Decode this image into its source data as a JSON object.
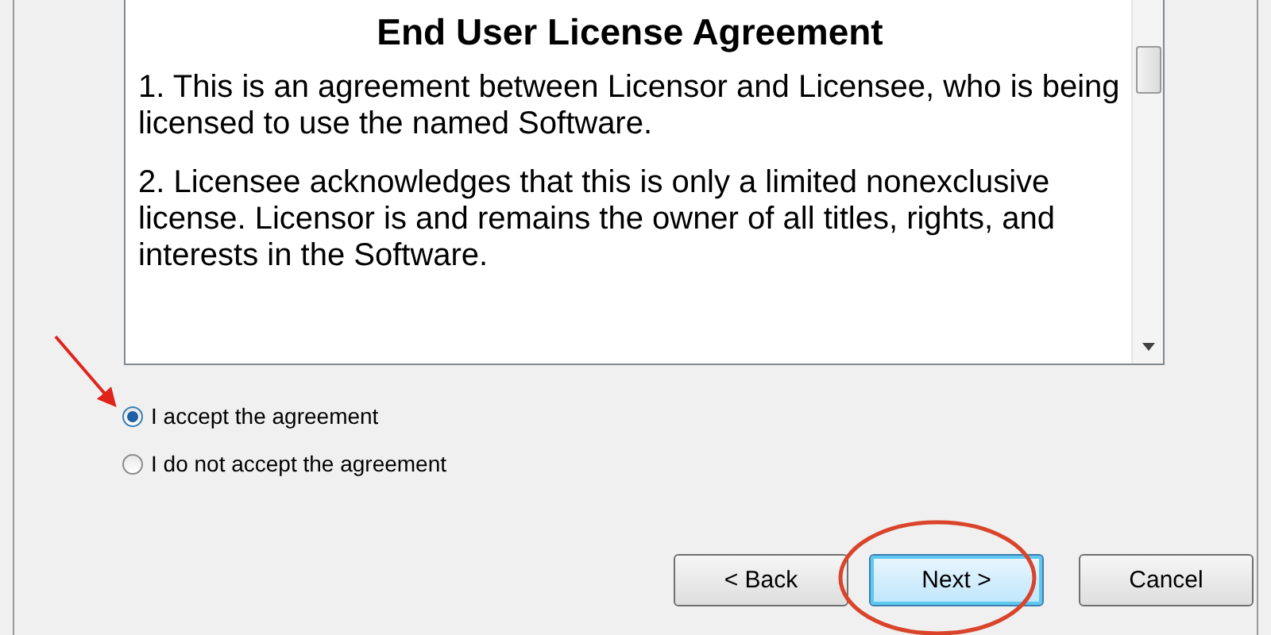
{
  "license": {
    "title": "End User License Agreement",
    "paragraphs": [
      "1. This is an agreement between Licensor and Licensee, who is being licensed to use the named Software.",
      "2. Licensee acknowledges that this is only a limited nonexclusive license. Licensor is and remains the owner of all titles, rights, and interests in the Software."
    ]
  },
  "options": [
    {
      "label": "I accept the agreement",
      "selected": true
    },
    {
      "label": "I do not accept the agreement",
      "selected": false
    }
  ],
  "buttons": [
    {
      "label": "< Back",
      "focused": false
    },
    {
      "label": "Next >",
      "focused": true
    },
    {
      "label": "Cancel",
      "focused": false
    }
  ]
}
